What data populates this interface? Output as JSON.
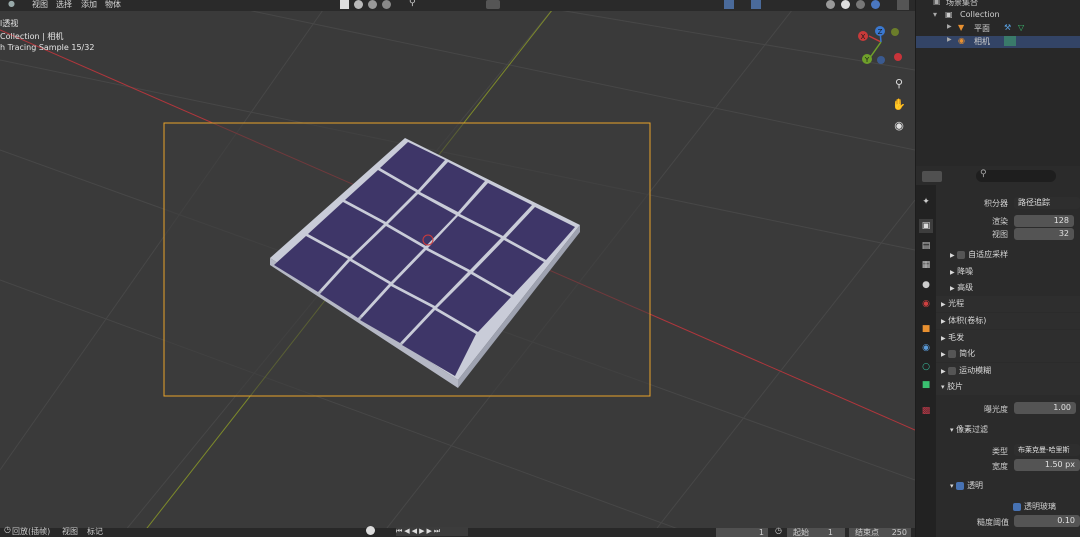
{
  "menu": {
    "item0": "视图",
    "item1": "选择",
    "item2": "添加",
    "item3": "物体"
  },
  "viewport": {
    "view_mode": "l透视",
    "collection_path": "Collection | 相机",
    "render_status": "h Tracing Sample 15/32",
    "axes": {
      "x": "X",
      "y": "Y",
      "z": "Z"
    }
  },
  "outliner": {
    "title": "场景集合",
    "collection": "Collection",
    "items": [
      {
        "label": "平面"
      },
      {
        "label": "相机"
      }
    ]
  },
  "properties": {
    "integrator_label": "积分器",
    "integrator_value": "路径追踪",
    "render_label": "渲染",
    "render_value": "128",
    "viewport_label": "视图",
    "viewport_value": "32",
    "adaptive": "自适应采样",
    "denoise": "降噪",
    "advanced": "高级",
    "light_paths": "光程",
    "volumes": "体积(卷标)",
    "hair": "毛发",
    "simplify": "简化",
    "motion_blur": "运动模糊",
    "film": "胶片",
    "exposure_label": "曝光度",
    "exposure_value": "1.00",
    "pixel_filter": "像素过滤",
    "type_label": "类型",
    "type_value": "布莱克曼-哈里斯",
    "width_label": "宽度",
    "width_value": "1.50 px",
    "transparent": "透明",
    "transparent_glass": "透明玻璃",
    "roughness_label": "糙度阈值",
    "roughness_value": "0.10"
  },
  "timeline": {
    "playback": "回放(插帧)",
    "view": "视图",
    "marker": "标记",
    "current_frame": "1",
    "start_label": "起始",
    "start_value": "1",
    "end_label": "结束点",
    "end_value": "250"
  }
}
